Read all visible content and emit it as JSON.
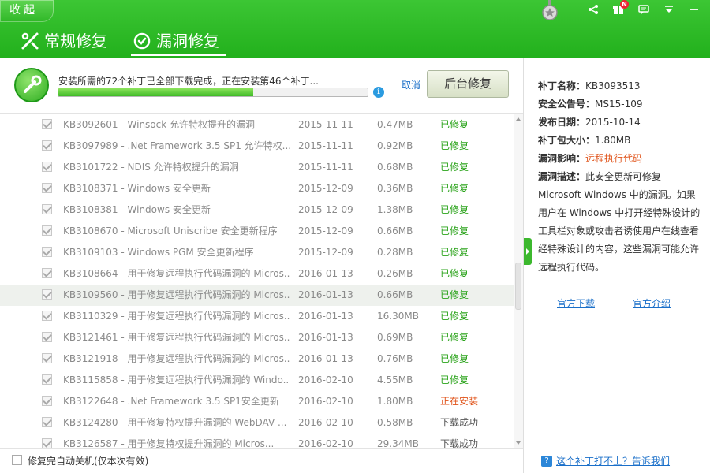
{
  "header": {
    "collapse_label": "收起",
    "tabs": [
      {
        "label": "常规修复",
        "active": false
      },
      {
        "label": "漏洞修复",
        "active": true
      }
    ],
    "notification_badge": "N",
    "colors": {
      "brand_green": "#22b01c",
      "link_blue": "#1a6fc9",
      "status_installing": "#e0541b"
    }
  },
  "progress": {
    "message": "安装所需的72个补丁已全部下载完成，正在安装第46个补丁...",
    "percent": 63,
    "cancel_label": "取消",
    "background_button_label": "后台修复"
  },
  "patches": [
    {
      "name": "KB3092601 - Winsock 允许特权提升的漏洞",
      "date": "2015-11-11",
      "size": "0.47MB",
      "status": "已修复",
      "kind": "done"
    },
    {
      "name": "KB3097989 - .Net Framework 3.5 SP1 允许特权...",
      "date": "2015-11-11",
      "size": "0.92MB",
      "status": "已修复",
      "kind": "done"
    },
    {
      "name": "KB3101722 - NDIS 允许特权提升的漏洞",
      "date": "2015-11-11",
      "size": "0.68MB",
      "status": "已修复",
      "kind": "done"
    },
    {
      "name": "KB3108371 - Windows 安全更新",
      "date": "2015-12-09",
      "size": "0.36MB",
      "status": "已修复",
      "kind": "done"
    },
    {
      "name": "KB3108381 - Windows 安全更新",
      "date": "2015-12-09",
      "size": "1.38MB",
      "status": "已修复",
      "kind": "done"
    },
    {
      "name": "KB3108670 - Microsoft Uniscribe 安全更新程序",
      "date": "2015-12-09",
      "size": "0.66MB",
      "status": "已修复",
      "kind": "done"
    },
    {
      "name": "KB3109103 - Windows PGM 安全更新程序",
      "date": "2015-12-09",
      "size": "0.28MB",
      "status": "已修复",
      "kind": "done"
    },
    {
      "name": "KB3108664 - 用于修复远程执行代码漏洞的 Micros...",
      "date": "2016-01-13",
      "size": "0.26MB",
      "status": "已修复",
      "kind": "done"
    },
    {
      "name": "KB3109560 - 用于修复远程执行代码漏洞的 Micros...",
      "date": "2016-01-13",
      "size": "0.66MB",
      "status": "已修复",
      "kind": "done",
      "highlight": true
    },
    {
      "name": "KB3110329 - 用于修复远程执行代码漏洞的 Micros...",
      "date": "2016-01-13",
      "size": "16.30MB",
      "status": "已修复",
      "kind": "done"
    },
    {
      "name": "KB3121461 - 用于修复远程执行代码漏洞的 Micros...",
      "date": "2016-01-13",
      "size": "0.69MB",
      "status": "已修复",
      "kind": "done"
    },
    {
      "name": "KB3121918 - 用于修复远程执行代码漏洞的 Micros...",
      "date": "2016-01-13",
      "size": "0.76MB",
      "status": "已修复",
      "kind": "done"
    },
    {
      "name": "KB3115858 - 用于修复远程执行代码漏洞的 Windo...",
      "date": "2016-02-10",
      "size": "4.55MB",
      "status": "已修复",
      "kind": "done"
    },
    {
      "name": "KB3122648 - .Net Framework 3.5 SP1安全更新",
      "date": "2016-02-10",
      "size": "1.80MB",
      "status": "正在安装",
      "kind": "installing"
    },
    {
      "name": "KB3124280 - 用于修复特权提升漏洞的 WebDAV ...",
      "date": "2016-02-10",
      "size": "0.58MB",
      "status": "下载成功",
      "kind": "downloaded"
    },
    {
      "name": "KB3126587 - 用于修复特权提升漏洞的 Micros...",
      "date": "2016-02-10",
      "size": "29.34MB",
      "status": "下载成功",
      "kind": "downloaded"
    }
  ],
  "footer": {
    "auto_shutdown_label": "修复完自动关机(仅本次有效)"
  },
  "details": {
    "name_label": "补丁名称：",
    "name_value": "KB3093513",
    "bulletin_label": "安全公告号：",
    "bulletin_value": "MS15-109",
    "date_label": "发布日期：",
    "date_value": "2015-10-14",
    "size_label": "补丁包大小：",
    "size_value": "1.80MB",
    "impact_label": "漏洞影响：",
    "impact_value": "远程执行代码",
    "desc_label": "漏洞描述：",
    "desc_value": "此安全更新可修复 Microsoft Windows 中的漏洞。如果用户在 Windows 中打开经特殊设计的工具栏对象或攻击者诱使用户在线查看经特殊设计的内容，这些漏洞可能允许远程执行代码。",
    "official_download": "官方下载",
    "official_intro": "官方介绍"
  },
  "feedback": {
    "label": "这个补丁打不上？告诉我们"
  }
}
